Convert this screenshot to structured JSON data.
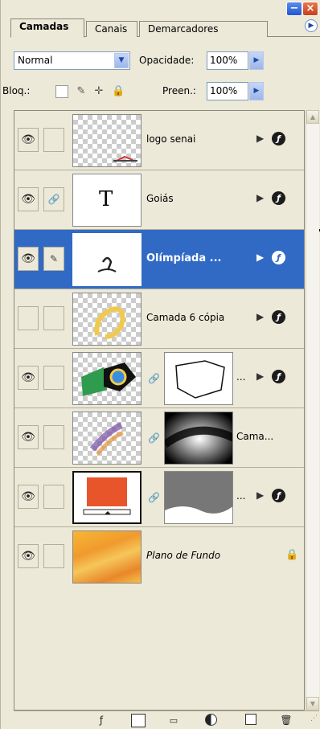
{
  "window": {
    "minimize_glyph": "−",
    "close_glyph": "×"
  },
  "tabs": [
    {
      "label": "Camadas",
      "active": true
    },
    {
      "label": "Canais",
      "active": false
    },
    {
      "label": "Demarcadores",
      "active": false
    }
  ],
  "panel_menu_glyph": "▶",
  "blend": {
    "mode": "Normal",
    "opacity_label": "Opacidade:",
    "opacity": "100%"
  },
  "lock": {
    "label": "Bloq.:",
    "fill_label": "Preen.:",
    "fill": "100%"
  },
  "icons": {
    "eye": "👁",
    "brush": "✎",
    "chain": "🔗",
    "move": "✛",
    "lock": "🔒",
    "fx_triangle": "▶",
    "fx_ball": "ƒ"
  },
  "layers": [
    {
      "name": "logo senai",
      "visible": true,
      "type": "normal"
    },
    {
      "name": "Goiás",
      "visible": true,
      "type": "text",
      "thumb_text": "T"
    },
    {
      "name": "Olímpíada ...",
      "visible": true,
      "type": "selected"
    },
    {
      "name": "Camada 6 cópia",
      "visible": false,
      "type": "normal"
    },
    {
      "name": "...",
      "visible": true,
      "type": "masked"
    },
    {
      "name": "Cama...",
      "visible": true,
      "type": "masked"
    },
    {
      "name": "...",
      "visible": true,
      "type": "masked"
    },
    {
      "name": "Plano de Fundo",
      "visible": true,
      "type": "background"
    }
  ],
  "toolbar": {
    "icons": [
      "fx-icon",
      "mask-icon",
      "folder-icon",
      "adjustment-icon",
      "new-layer-icon",
      "trash-icon"
    ]
  }
}
